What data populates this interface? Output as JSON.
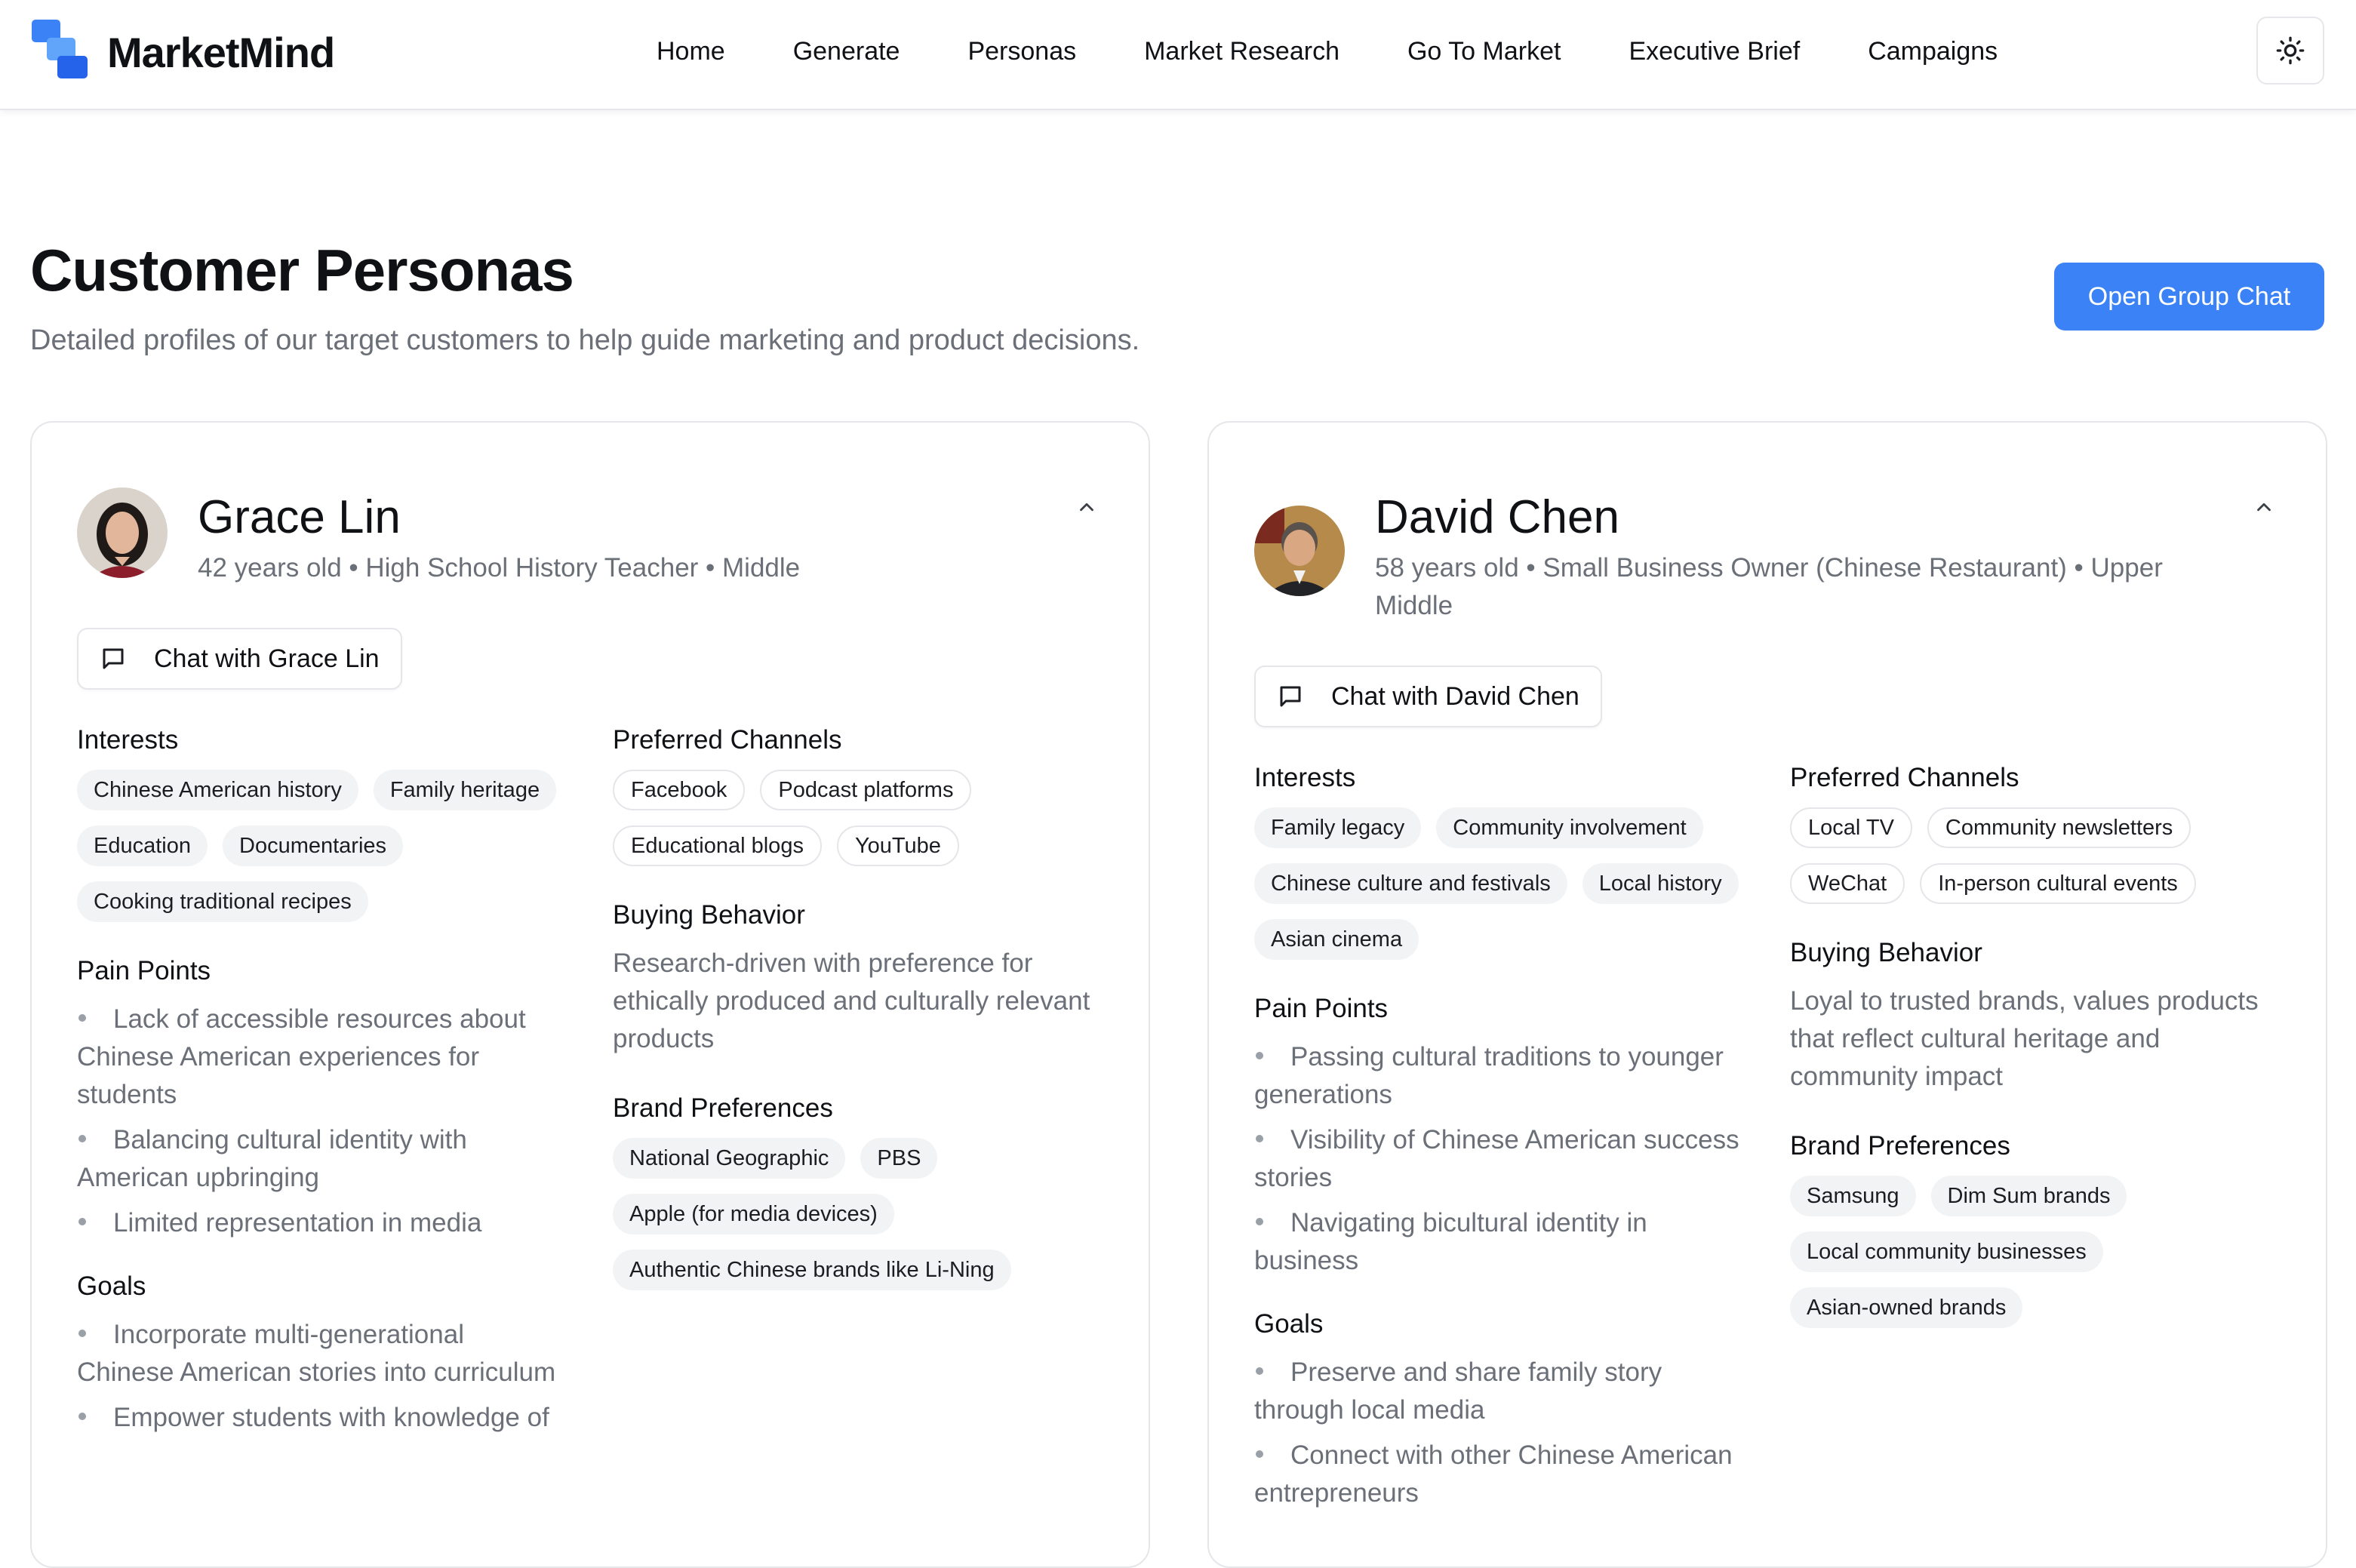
{
  "app": {
    "brand": "MarketMind"
  },
  "nav": {
    "items": [
      "Home",
      "Generate",
      "Personas",
      "Market Research",
      "Go To Market",
      "Executive Brief",
      "Campaigns"
    ]
  },
  "header": {
    "theme_icon": "sun-icon"
  },
  "page": {
    "title": "Customer Personas",
    "subtitle": "Detailed profiles of our target customers to help guide marketing and product decisions.",
    "group_chat_label": "Open Group Chat"
  },
  "colors": {
    "accent": "#3b82f6",
    "logo": "#3b82f6"
  },
  "personas": [
    {
      "name": "Grace Lin",
      "meta": "42 years old • High School History Teacher • Middle",
      "chat_label": "Chat with Grace Lin",
      "interests_title": "Interests",
      "interests": [
        "Chinese American history",
        "Family heritage",
        "Education",
        "Documentaries",
        "Cooking traditional recipes"
      ],
      "pain_title": "Pain Points",
      "pain_points": [
        "Lack of accessible resources about Chinese American experiences for students",
        "Balancing cultural identity with American upbringing",
        "Limited representation in media"
      ],
      "goals_title": "Goals",
      "goals": [
        "Incorporate multi-generational Chinese American stories into curriculum",
        "Empower students with knowledge of"
      ],
      "channels_title": "Preferred Channels",
      "channels": [
        "Facebook",
        "Podcast platforms",
        "Educational blogs",
        "YouTube"
      ],
      "buying_title": "Buying Behavior",
      "buying": "Research-driven with preference for ethically produced and culturally relevant products",
      "brands_title": "Brand Preferences",
      "brands": [
        "National Geographic",
        "PBS",
        "Apple (for media devices)",
        "Authentic Chinese brands like Li-Ning"
      ]
    },
    {
      "name": "David Chen",
      "meta": "58 years old • Small Business Owner (Chinese Restaurant) • Upper Middle",
      "chat_label": "Chat with David Chen",
      "interests_title": "Interests",
      "interests": [
        "Family legacy",
        "Community involvement",
        "Chinese culture and festivals",
        "Local history",
        "Asian cinema"
      ],
      "pain_title": "Pain Points",
      "pain_points": [
        "Passing cultural traditions to younger generations",
        "Visibility of Chinese American success stories",
        "Navigating bicultural identity in business"
      ],
      "goals_title": "Goals",
      "goals": [
        "Preserve and share family story through local media",
        "Connect with other Chinese American entrepreneurs"
      ],
      "channels_title": "Preferred Channels",
      "channels": [
        "Local TV",
        "Community newsletters",
        "WeChat",
        "In-person cultural events"
      ],
      "buying_title": "Buying Behavior",
      "buying": "Loyal to trusted brands, values products that reflect cultural heritage and community impact",
      "brands_title": "Brand Preferences",
      "brands": [
        "Samsung",
        "Dim Sum brands",
        "Local community businesses",
        "Asian-owned brands"
      ]
    }
  ]
}
